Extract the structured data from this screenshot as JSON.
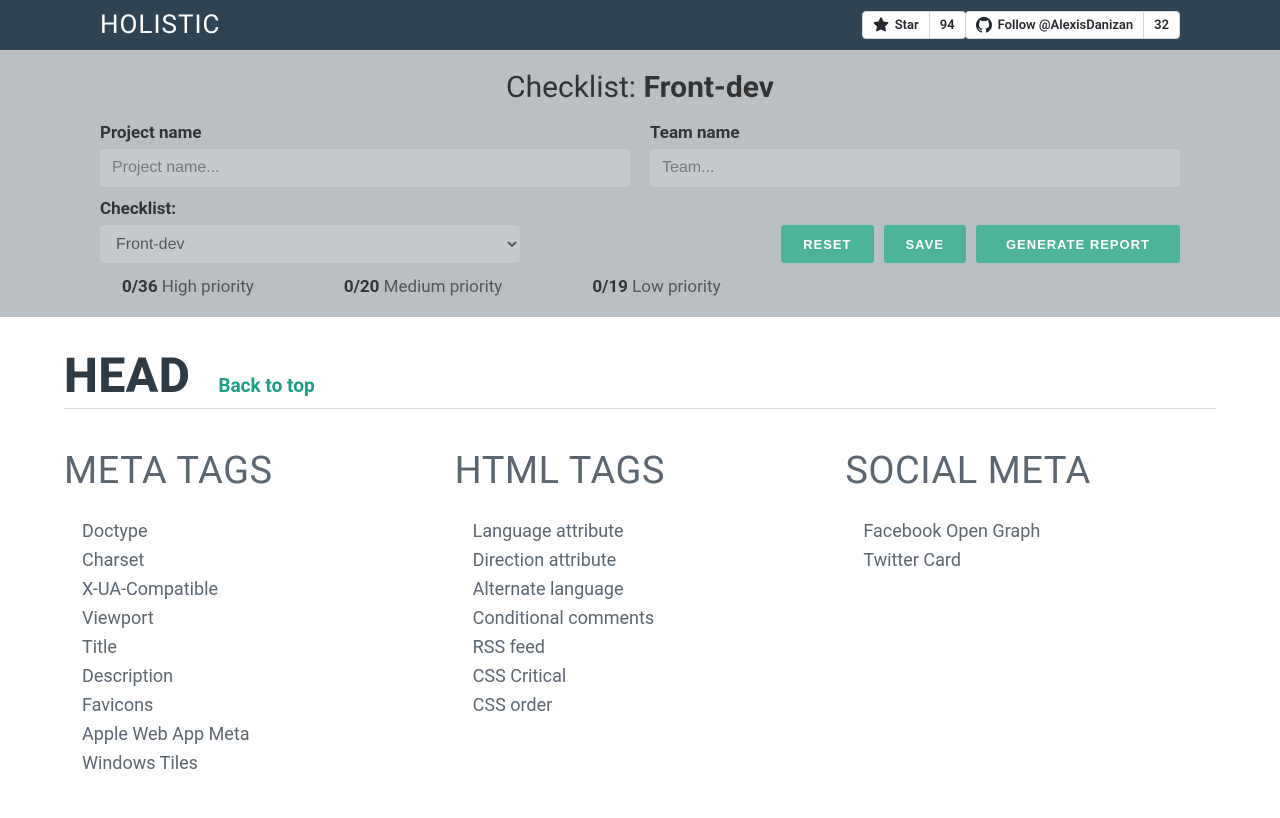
{
  "header": {
    "logo": "HOLISTIC",
    "star_label": "Star",
    "star_count": "94",
    "follow_label": "Follow @AlexisDanizan",
    "follow_count": "32"
  },
  "panel": {
    "title_prefix": "Checklist: ",
    "title_bold": "Front-dev",
    "project_label": "Project name",
    "project_placeholder": "Project name...",
    "team_label": "Team name",
    "team_placeholder": "Team...",
    "checklist_label": "Checklist:",
    "checklist_value": "Front-dev",
    "reset": "RESET",
    "save": "SAVE",
    "generate": "GENERATE REPORT",
    "priority": {
      "high_count": "0/36",
      "high_label": " High priority",
      "med_count": "0/20",
      "med_label": " Medium priority",
      "low_count": "0/19",
      "low_label": " Low priority"
    }
  },
  "section": {
    "head": "HEAD",
    "back": "Back to top"
  },
  "columns": {
    "meta": {
      "title": "META TAGS",
      "items": [
        "Doctype",
        "Charset",
        "X-UA-Compatible",
        "Viewport",
        "Title",
        "Description",
        "Favicons",
        "Apple Web App Meta",
        "Windows Tiles"
      ]
    },
    "html": {
      "title": "HTML TAGS",
      "items": [
        "Language attribute",
        "Direction attribute",
        "Alternate language",
        "Conditional comments",
        "RSS feed",
        "CSS Critical",
        "CSS order"
      ]
    },
    "social": {
      "title": "SOCIAL META",
      "items": [
        "Facebook Open Graph",
        "Twitter Card"
      ]
    }
  }
}
